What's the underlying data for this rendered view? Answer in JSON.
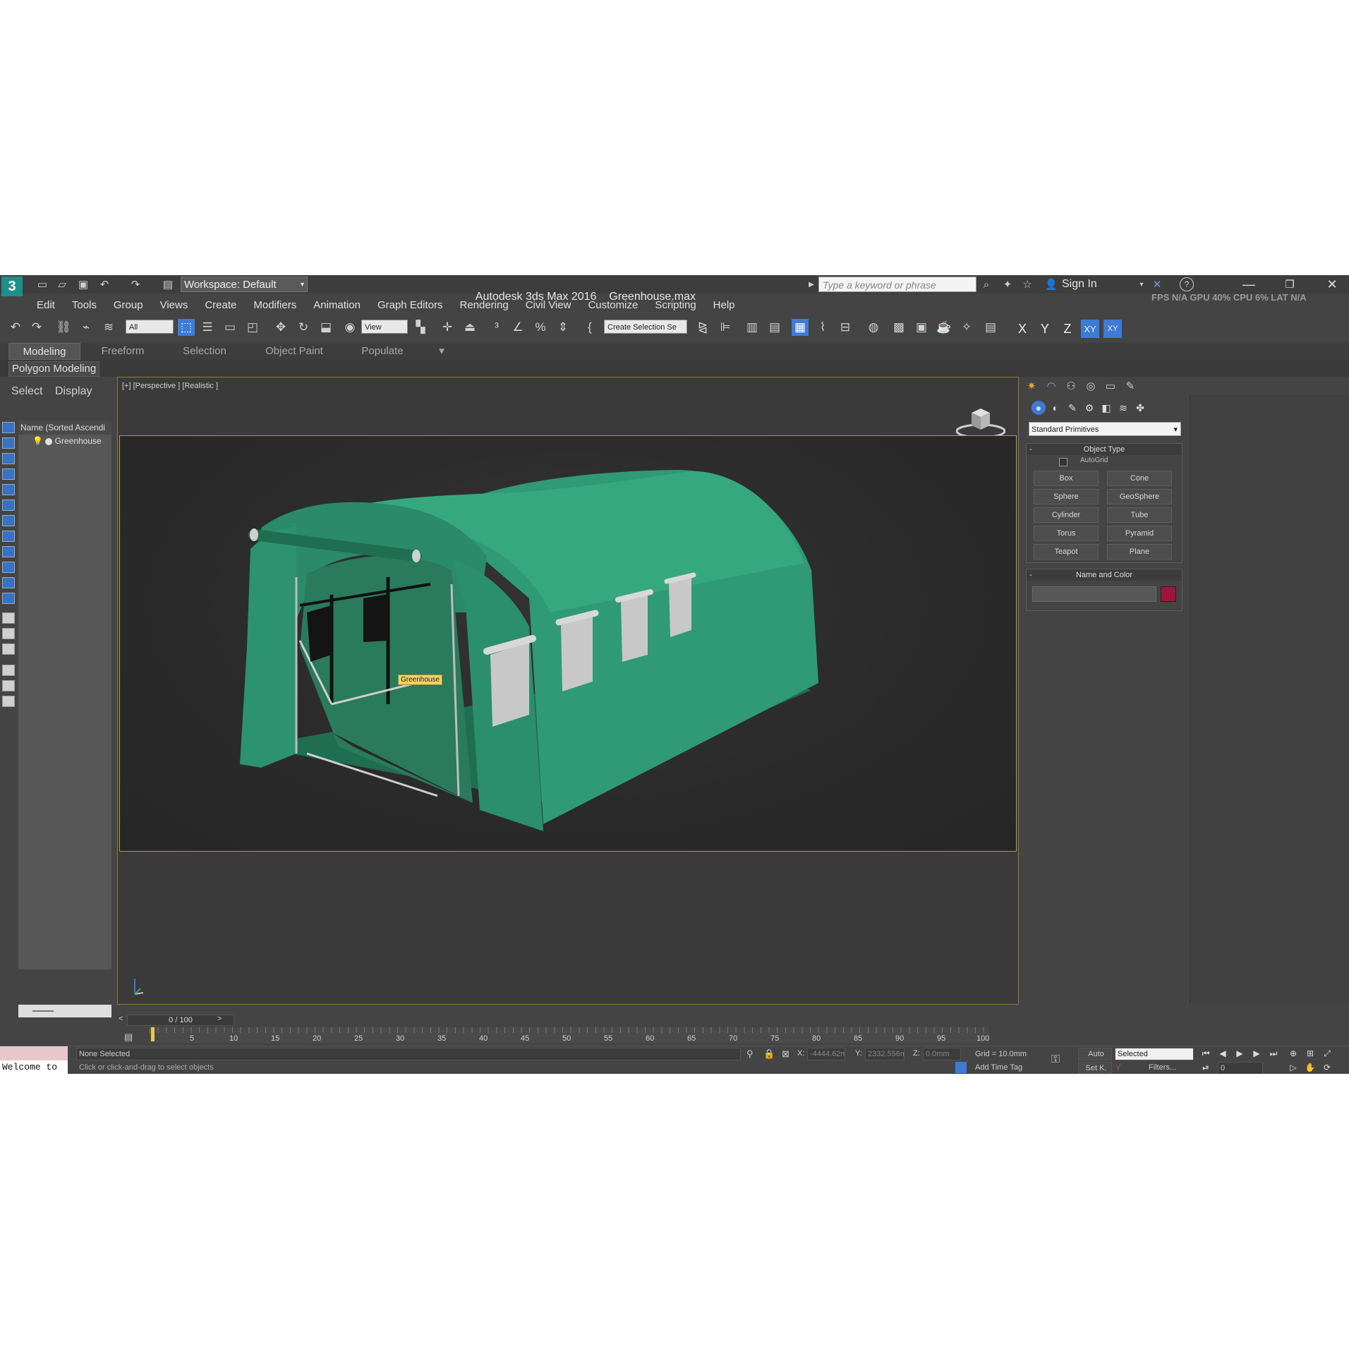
{
  "titlebar": {
    "app_title": "Autodesk 3ds Max 2016",
    "file_name": "Greenhouse.max",
    "workspace": "Workspace: Default",
    "search_placeholder": "Type a keyword or phrase",
    "sign_in": "Sign In",
    "stats": "FPS  N/A  GPU  40%  CPU  6%  LAT  N/A",
    "logo_label": "MAX"
  },
  "menu": [
    "Edit",
    "Tools",
    "Group",
    "Views",
    "Create",
    "Modifiers",
    "Animation",
    "Graph Editors",
    "Rendering",
    "Civil View",
    "Customize",
    "Scripting",
    "Help"
  ],
  "toolbar": {
    "selection_filter": "All",
    "ref_coord": "View",
    "named_selection": "Create Selection Se",
    "axes": [
      "X",
      "Y",
      "Z",
      "XY",
      "XY"
    ]
  },
  "ribbon": {
    "tabs": [
      "Modeling",
      "Freeform",
      "Selection",
      "Object Paint",
      "Populate"
    ],
    "active_tab": "Modeling",
    "panel": "Polygon Modeling"
  },
  "scene_explorer": {
    "tabs": [
      "Select",
      "Display"
    ],
    "column_header": "Name (Sorted Ascendi",
    "objects": [
      "Greenhouse"
    ]
  },
  "viewport": {
    "label": "[+] [Perspective ] [Realistic ]",
    "object_tooltip": "Greenhouse",
    "colors": {
      "greenhouse": "#2f9a75",
      "greenhouse_dark": "#1f6e52",
      "windows": "#c8c8c8",
      "frame": "#b8b8b8"
    }
  },
  "command_panel": {
    "category": "Standard Primitives",
    "object_type_title": "Object Type",
    "autogrid": "AutoGrid",
    "primitives": [
      "Box",
      "Cone",
      "Sphere",
      "GeoSphere",
      "Cylinder",
      "Tube",
      "Torus",
      "Pyramid",
      "Teapot",
      "Plane"
    ],
    "name_color_title": "Name and Color",
    "object_color": "#a0143c"
  },
  "timeline": {
    "slider_text": "0 / 100",
    "ticks": [
      "5",
      "10",
      "15",
      "20",
      "25",
      "30",
      "35",
      "40",
      "45",
      "50",
      "55",
      "60",
      "65",
      "70",
      "75",
      "80",
      "85",
      "90",
      "95",
      "100"
    ]
  },
  "statusbar": {
    "maxscript": "Welcome to",
    "selection_status": "None Selected",
    "prompt": "Click or click-and-drag to select objects",
    "x_label": "X:",
    "x_value": "-4444.62m",
    "y_label": "Y:",
    "y_value": "2332.556m",
    "z_label": "Z:",
    "z_value": "0.0mm",
    "grid": "Grid = 10.0mm",
    "add_time_tag": "Add Time Tag",
    "auto_key": "Auto",
    "set_key": "Set K.",
    "key_mode": "Selected",
    "filters": "Filters...",
    "frame": "0"
  }
}
